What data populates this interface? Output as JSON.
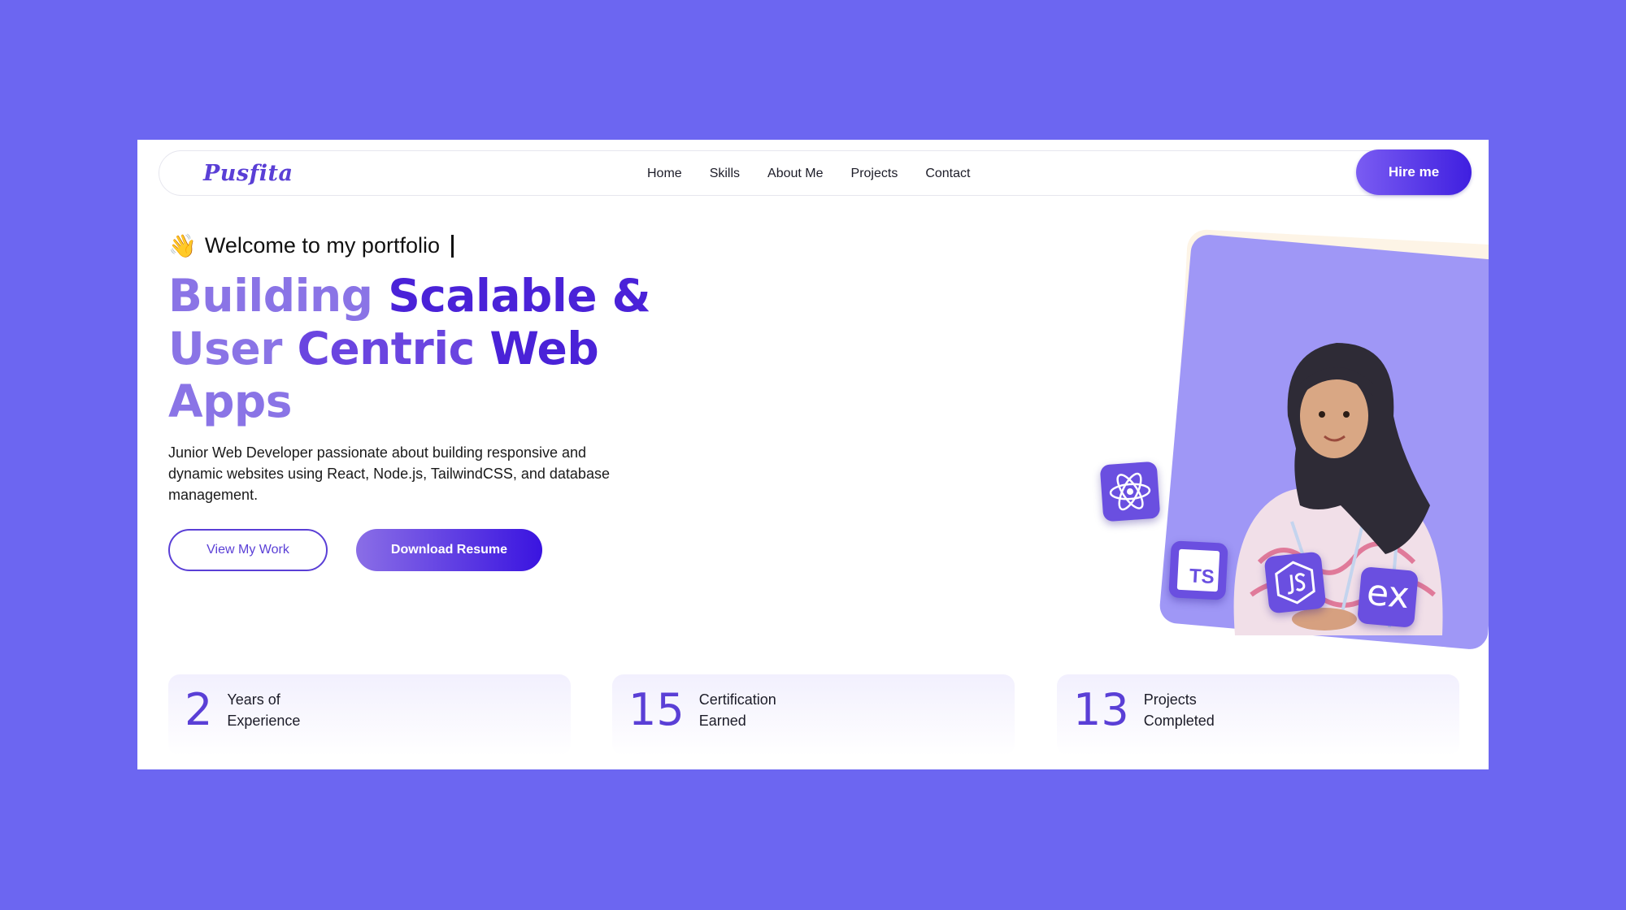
{
  "nav": {
    "logo": "Pusfita",
    "links": [
      "Home",
      "Skills",
      "About Me",
      "Projects",
      "Contact"
    ],
    "cta": "Hire me"
  },
  "hero": {
    "welcome": "Welcome to my portfolio",
    "title_light_1": "Building ",
    "title_dark_1": "Scalable &",
    "title_light_2": "User ",
    "title_mid_2": "Centric ",
    "title_dark_2": "Web",
    "title_light_3": "Apps",
    "description": "Junior Web Developer passionate about building responsive and dynamic websites using React, Node.js, TailwindCSS, and database management.",
    "btn_view": "View My Work",
    "btn_resume": "Download Resume"
  },
  "badges": {
    "ts": "TS",
    "ex": "ex"
  },
  "stats": [
    {
      "value": "2",
      "label": "Years of Experience"
    },
    {
      "value": "15",
      "label": "Certification Earned"
    },
    {
      "value": "13",
      "label": "Projects Completed"
    }
  ],
  "colors": {
    "background": "#6C66F1",
    "accent": "#5a3fd6",
    "accent_dark": "#3f1fe0",
    "card": "#9f97f6"
  },
  "icons": [
    "waving-hand-icon",
    "react-icon",
    "typescript-icon",
    "nodejs-icon",
    "express-icon"
  ]
}
